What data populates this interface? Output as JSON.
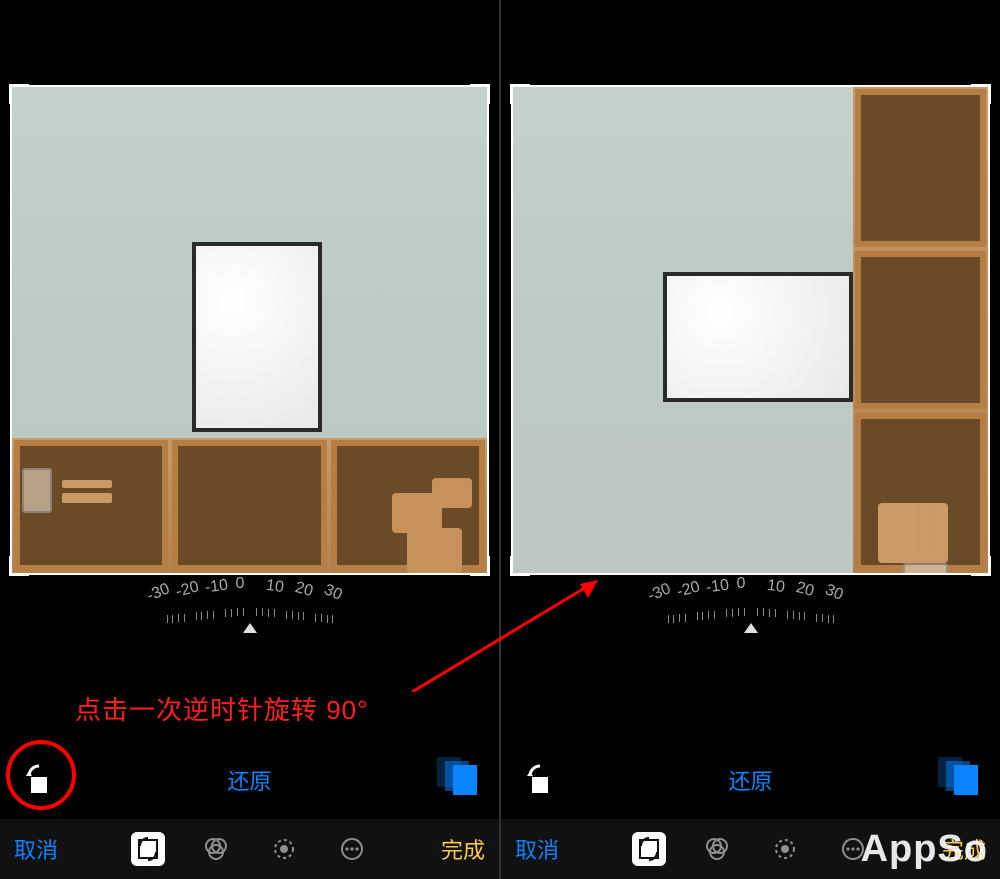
{
  "dial": {
    "labels": [
      "-30",
      "-20",
      "-10",
      "0",
      "10",
      "20",
      "30"
    ],
    "value": 0
  },
  "annotation": {
    "text": "点击一次逆时针旋转 90°"
  },
  "mid_toolbar": {
    "reset_label": "还原"
  },
  "bottom_bar": {
    "cancel_label": "取消",
    "done_label": "完成"
  },
  "tools": {
    "crop": "crop-rotate-tool",
    "filter": "filters-tool",
    "light": "light-color-tool",
    "more": "more-tool"
  },
  "watermark": "AppSo",
  "colors": {
    "accent_blue": "#0a84ff",
    "accent_yellow": "#f7c94c",
    "annotation_red": "#ff1e1e"
  }
}
